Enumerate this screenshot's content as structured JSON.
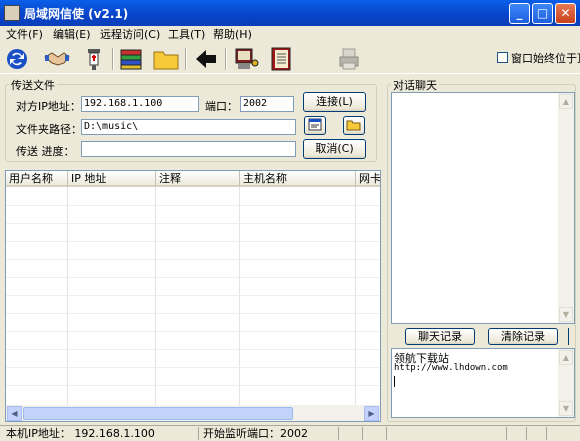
{
  "window": {
    "title": "局域网信使  (v2.1)"
  },
  "menu": [
    "文件(F)",
    "编辑(E)",
    "远程访问(C)",
    "工具(T)",
    "帮助(H)"
  ],
  "toolbar": {
    "always_on_top_label": "窗口始终位于顶"
  },
  "send": {
    "group_label": "传送文件",
    "peer_ip_label": "对方IP地址：",
    "peer_ip": "192.168.1.100",
    "port_label": "端口：",
    "port": "2002",
    "connect_label": "连接(L)",
    "folder_label": "文件夹路径：",
    "folder_path": "D:\\music\\",
    "progress_label": "传送 进度：",
    "cancel_label": "取消(C)"
  },
  "list": {
    "columns": [
      "用户名称",
      "IP 地址",
      "注释",
      "主机名称",
      "网卡"
    ]
  },
  "chat": {
    "group_label": "对话聊天",
    "history_label": "聊天记录",
    "clear_label": "清除记录",
    "input_lines": [
      "领航下载站",
      "http://www.lhdown.com"
    ]
  },
  "status": {
    "local_ip": "本机IP地址：  192.168.1.100",
    "listen_port": "开始监听端口：2002"
  },
  "colors": {
    "titlebar": "#0a5fe8",
    "face": "#ece9d8"
  }
}
